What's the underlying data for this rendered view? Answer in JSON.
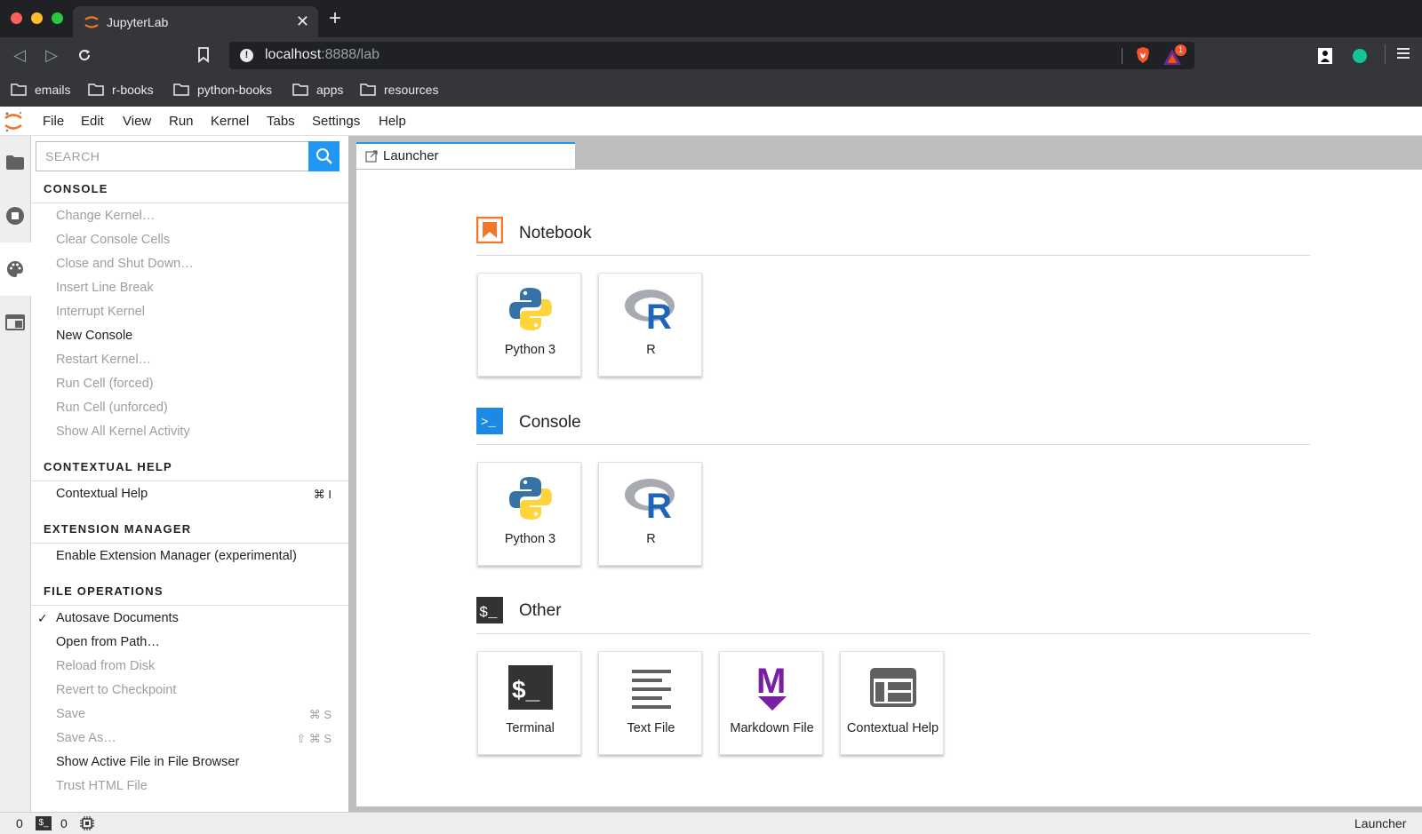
{
  "browser": {
    "tab_title": "JupyterLab",
    "tab_close": "✕",
    "new_tab": "+",
    "url_host": "localhost",
    "url_rest": ":8888/lab",
    "brave_badge": "1",
    "bookmarks": [
      "emails",
      "r-books",
      "python-books",
      "apps",
      "resources"
    ]
  },
  "menubar": {
    "items": [
      "File",
      "Edit",
      "View",
      "Run",
      "Kernel",
      "Tabs",
      "Settings",
      "Help"
    ]
  },
  "commands": {
    "search_placeholder": "SEARCH",
    "sections": [
      {
        "title": "CONSOLE",
        "items": [
          {
            "label": "Change Kernel…",
            "enabled": false
          },
          {
            "label": "Clear Console Cells",
            "enabled": false
          },
          {
            "label": "Close and Shut Down…",
            "enabled": false
          },
          {
            "label": "Insert Line Break",
            "enabled": false
          },
          {
            "label": "Interrupt Kernel",
            "enabled": false
          },
          {
            "label": "New Console",
            "enabled": true
          },
          {
            "label": "Restart Kernel…",
            "enabled": false
          },
          {
            "label": "Run Cell (forced)",
            "enabled": false
          },
          {
            "label": "Run Cell (unforced)",
            "enabled": false
          },
          {
            "label": "Show All Kernel Activity",
            "enabled": false
          }
        ]
      },
      {
        "title": "CONTEXTUAL HELP",
        "items": [
          {
            "label": "Contextual Help",
            "enabled": true,
            "shortcut": "⌘ I"
          }
        ]
      },
      {
        "title": "EXTENSION MANAGER",
        "items": [
          {
            "label": "Enable Extension Manager (experimental)",
            "enabled": true
          }
        ]
      },
      {
        "title": "FILE OPERATIONS",
        "items": [
          {
            "label": "Autosave Documents",
            "enabled": true,
            "checked": true
          },
          {
            "label": "Open from Path…",
            "enabled": true
          },
          {
            "label": "Reload from Disk",
            "enabled": false
          },
          {
            "label": "Revert to Checkpoint",
            "enabled": false
          },
          {
            "label": "Save",
            "enabled": false,
            "shortcut": "⌘ S"
          },
          {
            "label": "Save As…",
            "enabled": false,
            "shortcut": "⇧ ⌘ S"
          },
          {
            "label": "Show Active File in File Browser",
            "enabled": true
          },
          {
            "label": "Trust HTML File",
            "enabled": false
          }
        ]
      }
    ]
  },
  "launcher": {
    "tab_label": "Launcher",
    "sections": [
      {
        "title": "Notebook",
        "cards": [
          "Python 3",
          "R"
        ]
      },
      {
        "title": "Console",
        "cards": [
          "Python 3",
          "R"
        ]
      },
      {
        "title": "Other",
        "cards": [
          "Terminal",
          "Text File",
          "Markdown File",
          "Contextual Help"
        ]
      }
    ],
    "console_icon_text": ">_",
    "other_icon_text": "$_",
    "terminal_icon_text": "$_",
    "r_letter": "R",
    "markdown_letter": "M"
  },
  "status": {
    "terminals_count": "0",
    "kernels_count": "0",
    "terminal_badge": "$_",
    "right_label": "Launcher"
  },
  "colors": {
    "accent": "#2196f3",
    "notebook_orange": "#f37726",
    "markdown_purple": "#7b1fa2",
    "python_blue": "#3572a5",
    "python_yellow": "#ffd43b",
    "r_blue": "#1f65b7"
  }
}
